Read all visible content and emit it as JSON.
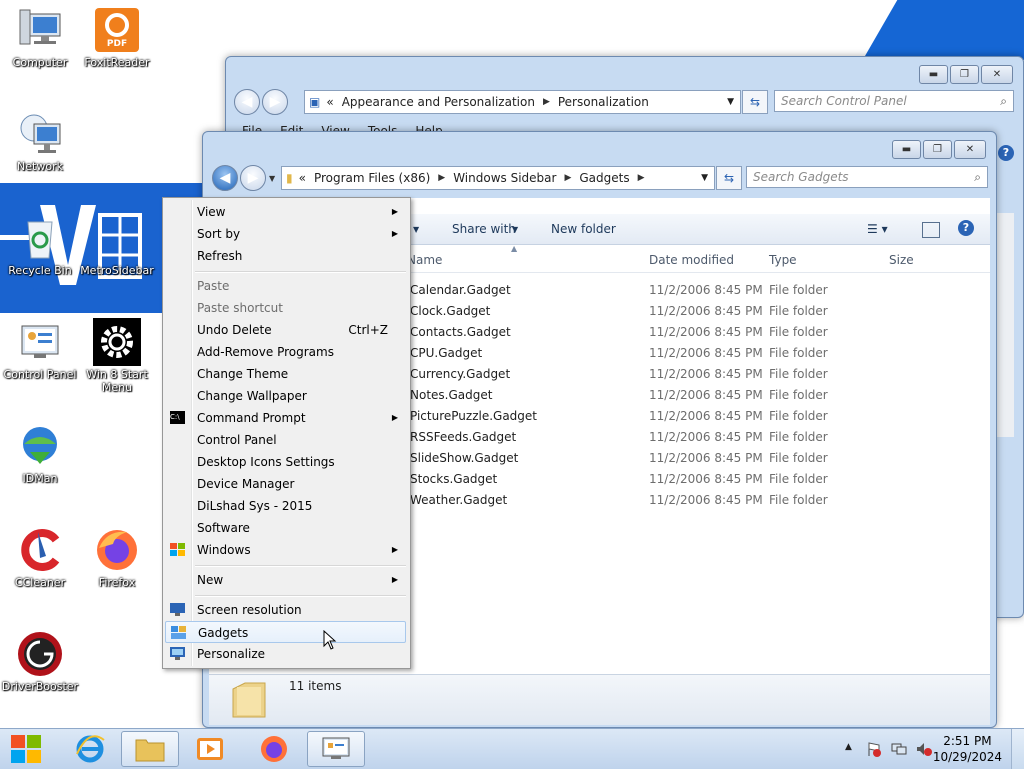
{
  "desktop": {
    "icons": [
      {
        "label": "Computer"
      },
      {
        "label": "FoxitReader"
      },
      {
        "label": "Network"
      },
      {
        "label": "Recycle Bin"
      },
      {
        "label": "MetroSidebar"
      },
      {
        "label": "Control Panel"
      },
      {
        "label": "Win 8 Start Menu"
      },
      {
        "label": "IDMan"
      },
      {
        "label": "CCleaner"
      },
      {
        "label": "Firefox"
      },
      {
        "label": "DriverBooster"
      }
    ],
    "foxit_badge": "PDF"
  },
  "back_window": {
    "address": {
      "prefix": "«",
      "crumbs": [
        "Appearance and Personalization",
        "Personalization"
      ]
    },
    "search_placeholder": "Search Control Panel",
    "menu": [
      "File",
      "Edit",
      "View",
      "Tools",
      "Help"
    ]
  },
  "explorer": {
    "address": {
      "prefix": "«",
      "crumbs": [
        "Program Files (x86)",
        "Windows Sidebar",
        "Gadgets"
      ]
    },
    "search_placeholder": "Search Gadgets",
    "toolbar": {
      "share_with": "Share with",
      "new_folder": "New folder"
    },
    "columns": {
      "name": "Name",
      "date": "Date modified",
      "type": "Type",
      "size": "Size"
    },
    "files": [
      {
        "name": "Calendar.Gadget",
        "date": "11/2/2006 8:45 PM",
        "type": "File folder"
      },
      {
        "name": "Clock.Gadget",
        "date": "11/2/2006 8:45 PM",
        "type": "File folder"
      },
      {
        "name": "Contacts.Gadget",
        "date": "11/2/2006 8:45 PM",
        "type": "File folder"
      },
      {
        "name": "CPU.Gadget",
        "date": "11/2/2006 8:45 PM",
        "type": "File folder"
      },
      {
        "name": "Currency.Gadget",
        "date": "11/2/2006 8:45 PM",
        "type": "File folder"
      },
      {
        "name": "Notes.Gadget",
        "date": "11/2/2006 8:45 PM",
        "type": "File folder"
      },
      {
        "name": "PicturePuzzle.Gadget",
        "date": "11/2/2006 8:45 PM",
        "type": "File folder"
      },
      {
        "name": "RSSFeeds.Gadget",
        "date": "11/2/2006 8:45 PM",
        "type": "File folder"
      },
      {
        "name": "SlideShow.Gadget",
        "date": "11/2/2006 8:45 PM",
        "type": "File folder"
      },
      {
        "name": "Stocks.Gadget",
        "date": "11/2/2006 8:45 PM",
        "type": "File folder"
      },
      {
        "name": "Weather.Gadget",
        "date": "11/2/2006 8:45 PM",
        "type": "File folder"
      }
    ],
    "status": "11 items"
  },
  "context_menu": {
    "view": "View",
    "sort_by": "Sort by",
    "refresh": "Refresh",
    "paste": "Paste",
    "paste_shortcut": "Paste shortcut",
    "undo_delete": "Undo Delete",
    "undo_shortcut": "Ctrl+Z",
    "add_remove": "Add-Remove Programs",
    "change_theme": "Change Theme",
    "change_wallpaper": "Change Wallpaper",
    "command_prompt": "Command Prompt",
    "cmd_icon_text": "C:\\",
    "control_panel": "Control Panel",
    "desktop_icons": "Desktop Icons Settings",
    "device_manager": "Device Manager",
    "dilshad": "DiLshad Sys - 2015",
    "software": "Software",
    "windows": "Windows",
    "new": "New",
    "screen_resolution": "Screen resolution",
    "gadgets": "Gadgets",
    "personalize": "Personalize"
  },
  "taskbar": {
    "time": "2:51 PM",
    "date": "10/29/2024"
  },
  "colors": {
    "accent": "#1a63cf",
    "highlight": "#cce4f7"
  }
}
